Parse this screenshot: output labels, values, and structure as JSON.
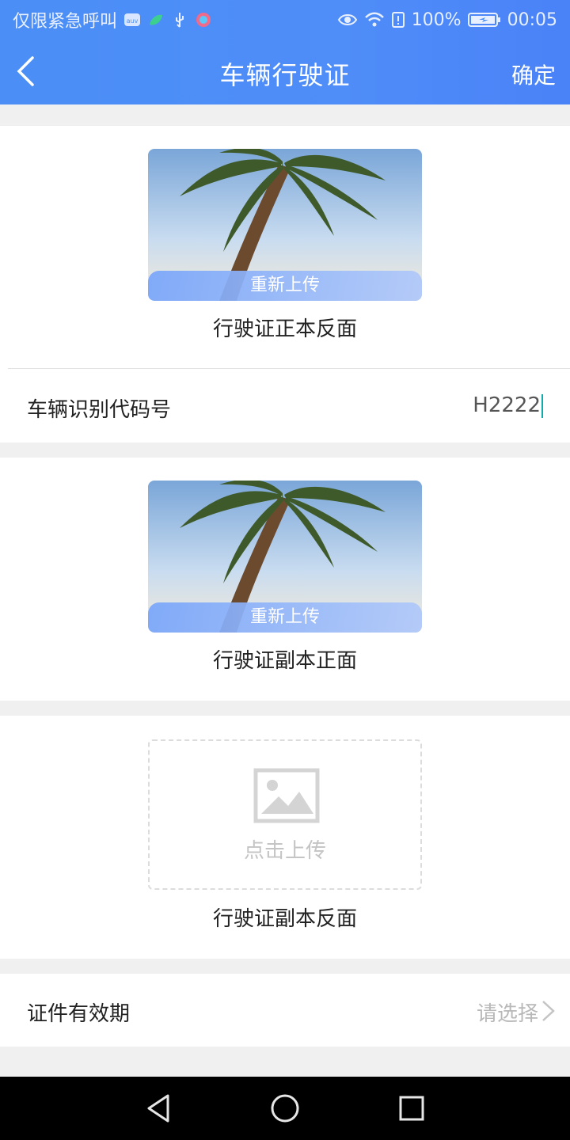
{
  "status_bar": {
    "carrier_text": "仅限紧急呼叫",
    "battery": "100%",
    "time": "00:05"
  },
  "header": {
    "title": "车辆行驶证",
    "confirm_label": "确定"
  },
  "photos": [
    {
      "caption": "行驶证正本反面",
      "reupload_label": "重新上传"
    },
    {
      "caption": "行驶证副本正面",
      "reupload_label": "重新上传"
    }
  ],
  "vin_row": {
    "label": "车辆识别代码号",
    "value": "H2222"
  },
  "upload_slot": {
    "caption": "行驶证副本反面",
    "upload_label": "点击上传"
  },
  "validity_row": {
    "label": "证件有效期",
    "placeholder": "请选择"
  },
  "colors": {
    "header_blue": "#4a8ef6",
    "background_gray": "#f0f0f0"
  },
  "icons": [
    "back-arrow-icon",
    "image-placeholder-icon",
    "chevron-right-icon",
    "eye-icon",
    "wifi-icon",
    "battery-icon",
    "usb-icon"
  ]
}
